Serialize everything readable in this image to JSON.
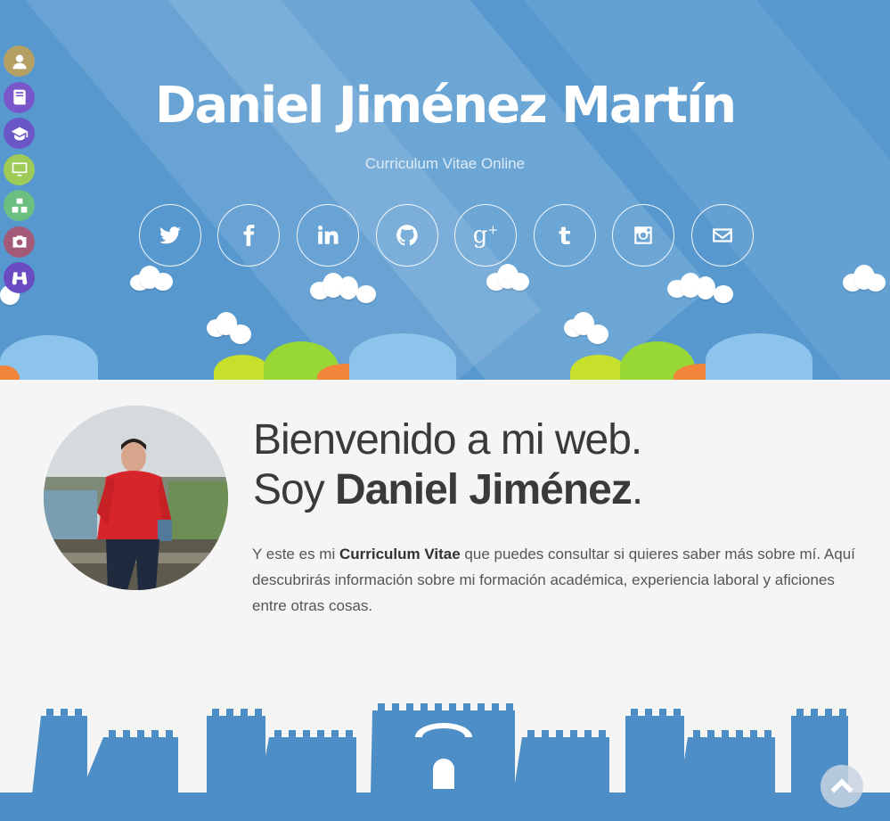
{
  "header": {
    "name": "Daniel Jiménez Martín",
    "tagline": "Curriculum Vitae Online"
  },
  "social_links": [
    {
      "name": "twitter",
      "icon": "twitter-icon"
    },
    {
      "name": "facebook",
      "icon": "facebook-icon"
    },
    {
      "name": "linkedin",
      "icon": "linkedin-icon"
    },
    {
      "name": "github",
      "icon": "github-icon"
    },
    {
      "name": "google-plus",
      "icon": "google-plus-icon"
    },
    {
      "name": "tumblr",
      "icon": "tumblr-icon"
    },
    {
      "name": "instagram",
      "icon": "instagram-icon"
    },
    {
      "name": "email",
      "icon": "envelope-icon"
    }
  ],
  "side_nav": [
    {
      "icon": "user-icon",
      "color": "#b5a064"
    },
    {
      "icon": "book-icon",
      "color": "#7a57c9"
    },
    {
      "icon": "graduation-cap-icon",
      "color": "#6b56c8"
    },
    {
      "icon": "monitor-icon",
      "color": "#9ecb57"
    },
    {
      "icon": "cubes-icon",
      "color": "#6cc07f"
    },
    {
      "icon": "camera-icon",
      "color": "#a35a79"
    },
    {
      "icon": "binoculars-icon",
      "color": "#6a4bc2"
    }
  ],
  "welcome": {
    "line1": "Bienvenido a mi web.",
    "line2_prefix": "Soy ",
    "line2_name": "Daniel Jiménez",
    "line2_suffix": ".",
    "intro_a": "Y este es mi ",
    "intro_b": "Curriculum Vitae",
    "intro_c": " que puedes consultar si quieres saber más sobre mí. Aquí descubrirás información sobre mi formación académica, experiencia laboral y aficiones entre otras cosas."
  },
  "colors": {
    "hero_bg": "#5799cf",
    "castle": "#4e8ec6",
    "text_dark": "#3a3a3a"
  }
}
